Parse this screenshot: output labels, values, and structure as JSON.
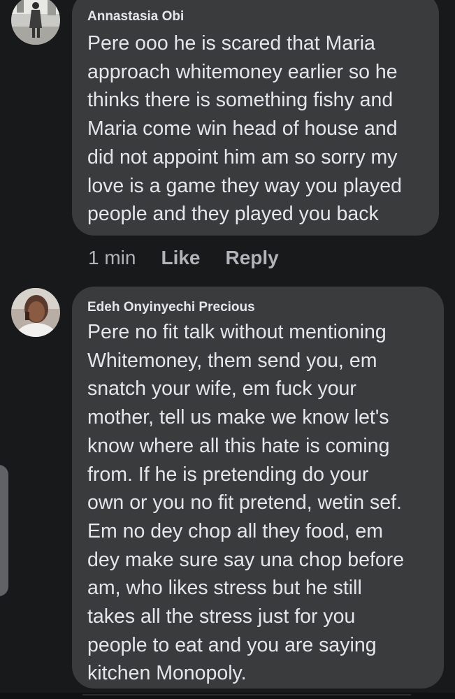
{
  "comments": [
    {
      "author": "Annastasia Obi",
      "text": "Pere ooo he is scared that Maria\napproach whitemoney earlier so he\nthinks there is something fishy and\nMaria come win head of house and\ndid not appoint him am so sorry my\nlove is a game they way you played\npeople and they played you back",
      "time": "1 min",
      "like_label": "Like",
      "reply_label": "Reply"
    },
    {
      "author": "Edeh Onyinyechi Precious",
      "text": "Pere no fit talk without mentioning\nWhitemoney, them send you, em\nsnatch your wife, em fuck your\nmother, tell us make we know let's\nknow where all this hate is coming\nfrom. If he is pretending do your\nown or you no fit pretend, wetin sef.\nEm no dey chop all they food, em\ndey make sure say una chop before\nam, who likes stress but he still\ntakes all the stress just for you\npeople to eat and you are saying\nkitchen Monopoly."
    }
  ],
  "colors": {
    "background": "#18191a",
    "bubble": "#3a3b3c",
    "primary_text": "#e4e6eb",
    "secondary_text": "#b0b3b8"
  }
}
